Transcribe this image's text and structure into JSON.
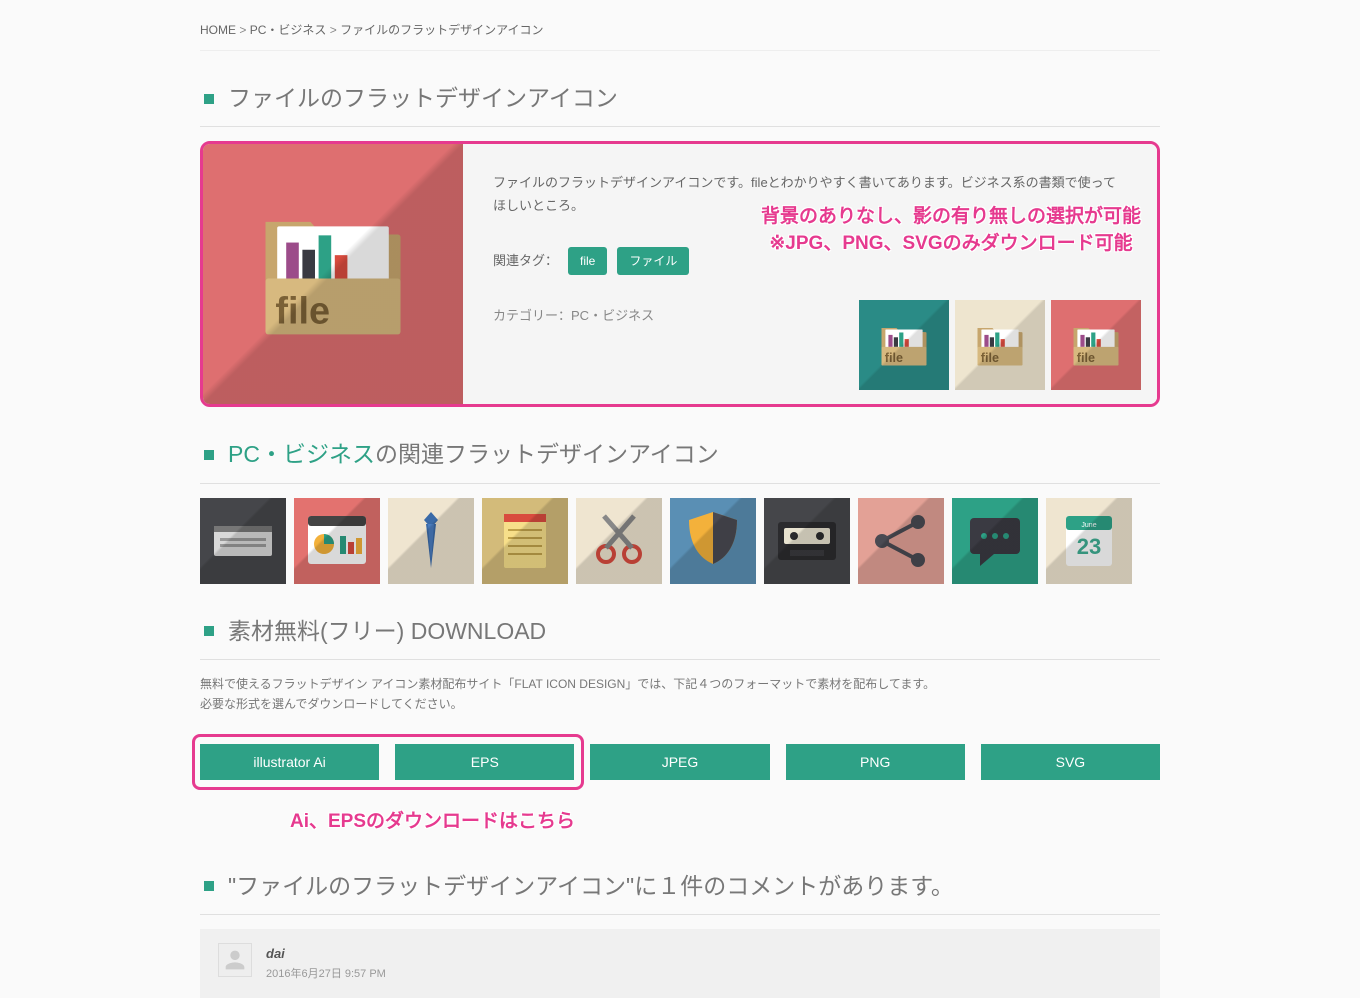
{
  "breadcrumb": {
    "home": "HOME",
    "sep": ">",
    "cat": "PC・ビジネス",
    "current": "ファイルのフラットデザインアイコン"
  },
  "heading_main": "ファイルのフラットデザインアイコン",
  "hero": {
    "description": "ファイルのフラットデザインアイコンです。fileとわかりやすく書いてあります。ビジネス系の書類で使ってほしいところ。",
    "tag_label": "関連タグ：",
    "tags": [
      "file",
      "ファイル"
    ],
    "cat_label": "カテゴリー：",
    "cat_value": "PC・ビジネス"
  },
  "overlay": {
    "line1": "背景のありなし、影の有り無しの選択が可能",
    "line2": "※JPG、PNG、SVGのみダウンロード可能"
  },
  "related_heading_link": "PC・ビジネス",
  "related_heading_suffix": "の関連フラットデザインアイコン",
  "related_items": [
    {
      "bg": "#45464a",
      "kind": "server"
    },
    {
      "bg": "#e3726f",
      "kind": "dashboard"
    },
    {
      "bg": "#efe5d0",
      "kind": "tie"
    },
    {
      "bg": "#d3bb7a",
      "kind": "notepad"
    },
    {
      "bg": "#efe5d0",
      "kind": "scissors"
    },
    {
      "bg": "#5a8fb4",
      "kind": "shield"
    },
    {
      "bg": "#45464a",
      "kind": "cassette"
    },
    {
      "bg": "#e3a196",
      "kind": "share"
    },
    {
      "bg": "#2da186",
      "kind": "chat"
    },
    {
      "bg": "#efe5d0",
      "kind": "calendar"
    }
  ],
  "download_heading": "素材無料(フリー) DOWNLOAD",
  "download_desc1": "無料で使えるフラットデザイン アイコン素材配布サイト「FLAT ICON DESIGN」では、下記４つのフォーマットで素材を配布してます。",
  "download_desc2": "必要な形式を選んでダウンロードしてください。",
  "download_buttons": [
    "illustrator Ai",
    "EPS",
    "JPEG",
    "PNG",
    "SVG"
  ],
  "download_note": "Ai、EPSのダウンロードはこちら",
  "comments_heading_prefix": "\"",
  "comments_heading_title": "ファイルのフラットデザインアイコン",
  "comments_heading_suffix": "\"に１件のコメントがあります。",
  "comment1": {
    "name": "dai",
    "date": "2016年6月27日 9:57 PM"
  }
}
